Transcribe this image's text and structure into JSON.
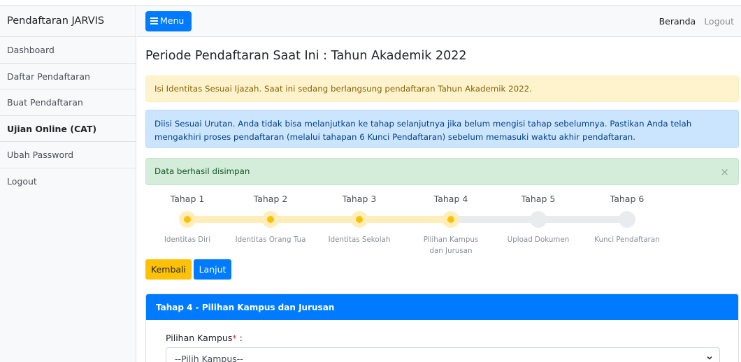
{
  "sidebar": {
    "brand": "Pendaftaran JARVIS",
    "items": [
      {
        "label": "Dashboard"
      },
      {
        "label": "Daftar Pendaftaran"
      },
      {
        "label": "Buat Pendaftaran"
      },
      {
        "label": "Ujian Online (CAT)"
      },
      {
        "label": "Ubah Password"
      },
      {
        "label": "Logout"
      }
    ]
  },
  "navbar": {
    "menu_label": "Menu",
    "menu_icon": "hamburger-icon",
    "beranda": "Beranda",
    "logout": "Logout"
  },
  "main": {
    "title": "Periode Pendaftaran Saat Ini : Tahun Akademik 2022",
    "alert_warning": "Isi Identitas Sesuai Ijazah. Saat ini sedang berlangsung pendaftaran Tahun Akademik 2022.",
    "alert_info": "Diisi Sesuai Urutan. Anda tidak bisa melanjutkan ke tahap selanjutnya jika belum mengisi tahap sebelumnya. Pastikan Anda telah mengakhiri proses pendaftaran (melalui tahapan 6 Kunci Pendaftaran) sebelum memasuki waktu akhir pendaftaran.",
    "alert_success": "Data berhasil disimpan",
    "alert_close": "×",
    "steps": [
      {
        "title": "Tahap 1",
        "label": "Identitas Diri",
        "active": true
      },
      {
        "title": "Tahap 2",
        "label": "Identitas Orang Tua",
        "active": true
      },
      {
        "title": "Tahap 3",
        "label": "Identitas Sekolah",
        "active": true
      },
      {
        "title": "Tahap 4",
        "label": "Pilihan Kampus dan Jurusan",
        "active": true
      },
      {
        "title": "Tahap 5",
        "label": "Upload Dokumen",
        "active": false
      },
      {
        "title": "Tahap 6",
        "label": "Kunci Pendaftaran",
        "active": false
      }
    ],
    "btn_kembali": "Kembali",
    "btn_lanjut": "Lanjut",
    "card_title": "Tahap 4 - Pilihan Kampus dan Jurusan",
    "field_label": "Pilihan Kampus",
    "field_required": "*",
    "field_suffix": " :",
    "select_value": "--Pilih Kampus--"
  },
  "colors": {
    "primary": "#007bff",
    "warning": "#ffc107",
    "step_active": "#ffeeba",
    "step_inactive": "#e9ecef"
  }
}
